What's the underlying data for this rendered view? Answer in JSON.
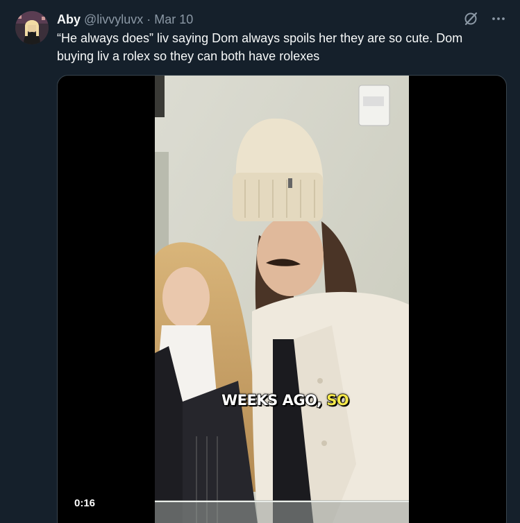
{
  "author": {
    "display_name": "Aby",
    "handle": "@livvyluvx",
    "separator": "·",
    "date": "Mar 10"
  },
  "tweet": {
    "text": "“He always does” liv saying Dom always spoils her they are so cute. Dom buying liv a rolex so they can both have rolexes"
  },
  "media": {
    "caption_main": "WEEKS AGO,",
    "caption_highlight": "SO",
    "timestamp": "0:16"
  },
  "icons": {
    "grok": "grok-slash-icon",
    "more": "more-dots-icon"
  },
  "colors": {
    "background": "#15202b",
    "text": "#f7f9f9",
    "secondary": "#8b98a5",
    "caption_highlight": "#f5e94b"
  }
}
